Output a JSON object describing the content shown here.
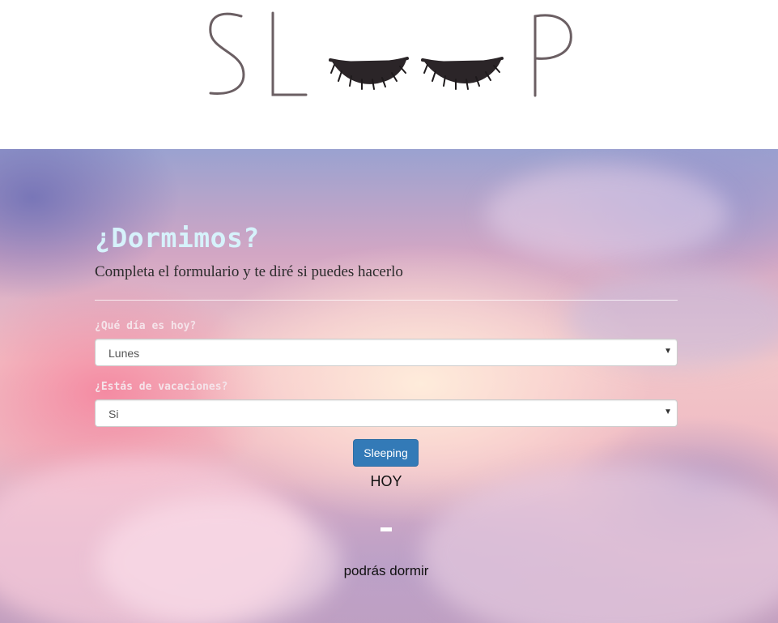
{
  "header": {
    "logo_text": "SLEEP"
  },
  "form": {
    "title": "¿Dormimos?",
    "subtitle": "Completa el formulario y te diré si puedes hacerlo",
    "day_label": "¿Qué día es hoy?",
    "day_value": "Lunes",
    "vacation_label": "¿Estás de vacaciones?",
    "vacation_value": "Si",
    "submit_label": "Sleeping"
  },
  "result": {
    "day": "HOY",
    "message": "podrás dormir"
  },
  "colors": {
    "title": "#d6f2fb",
    "button": "#337ab7",
    "label": "#f5e4ea"
  },
  "icons": {
    "select_arrow": "chevron-down-icon"
  }
}
